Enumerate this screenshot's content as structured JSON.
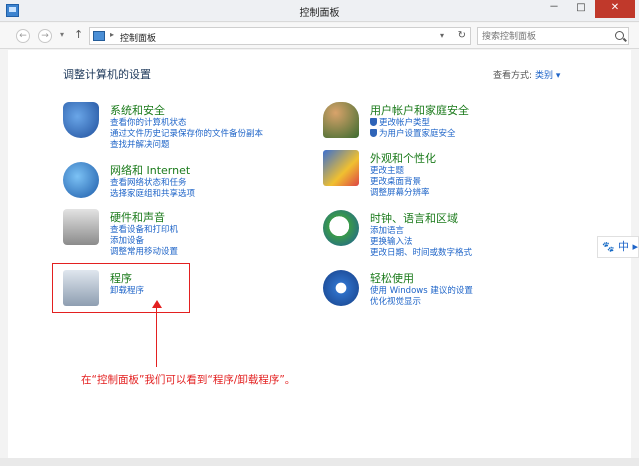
{
  "window": {
    "title": "控制面板",
    "buttons": {
      "minimize": "－",
      "maximize": "□",
      "close": "✕"
    }
  },
  "addressbar": {
    "back": "←",
    "forward": "→",
    "history_dropdown": "▾",
    "up": "↑",
    "path_separator": "▸",
    "path": "控制面板",
    "path_dropdown": "▾",
    "refresh": "↻",
    "search_placeholder": "搜索控制面板"
  },
  "content": {
    "heading": "调整计算机的设置",
    "view_by_label": "查看方式:",
    "view_by_value": "类别 ▾",
    "categories": [
      {
        "icon": "shield-icon",
        "title": "系统和安全",
        "links": [
          "查看你的计算机状态",
          "通过文件历史记录保存你的文件备份副本",
          "查找并解决问题"
        ]
      },
      {
        "icon": "network-globe-icon",
        "title": "网络和 Internet",
        "links": [
          "查看网络状态和任务",
          "选择家庭组和共享选项"
        ]
      },
      {
        "icon": "printer-icon",
        "title": "硬件和声音",
        "links": [
          "查看设备和打印机",
          "添加设备",
          "调整常用移动设置"
        ]
      },
      {
        "icon": "programs-icon",
        "title": "程序",
        "links": [
          "卸载程序"
        ]
      },
      {
        "icon": "users-icon",
        "title": "用户帐户和家庭安全",
        "links": [
          "更改帐户类型",
          "为用户设置家庭安全"
        ]
      },
      {
        "icon": "appearance-icon",
        "title": "外观和个性化",
        "links": [
          "更改主题",
          "更改桌面背景",
          "调整屏幕分辨率"
        ]
      },
      {
        "icon": "clock-globe-icon",
        "title": "时钟、语言和区域",
        "links": [
          "添加语言",
          "更换输入法",
          "更改日期、时间或数字格式"
        ]
      },
      {
        "icon": "ease-of-access-icon",
        "title": "轻松使用",
        "links": [
          "使用 Windows 建议的设置",
          "优化视觉显示"
        ]
      }
    ]
  },
  "annotation": {
    "text": "在“控制面板”我们可以看到“程序/卸载程序”。",
    "color": "#e32020"
  },
  "ime": {
    "icon": "paw-icon",
    "label": "中",
    "arrow": "▸"
  },
  "colors": {
    "category_title": "#1a7a1a",
    "link": "#1e64c8",
    "heading": "#1e395b"
  }
}
